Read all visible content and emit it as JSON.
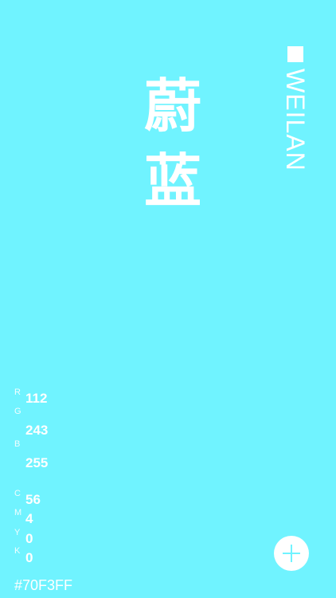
{
  "color": {
    "name_cn": [
      "蔚",
      "蓝"
    ],
    "name_pinyin": "WEILAN",
    "hex": "#70F3FF",
    "background": "#70F3FF"
  },
  "rgb": {
    "labels": [
      "R",
      "G",
      "B"
    ],
    "values": [
      "112",
      "243",
      "255"
    ]
  },
  "cmyk": {
    "labels": [
      "C",
      "M",
      "Y",
      "K"
    ],
    "values": [
      "56",
      "4",
      "0",
      "0"
    ]
  },
  "icons": {
    "marker": "square-icon",
    "add": "plus-icon"
  }
}
